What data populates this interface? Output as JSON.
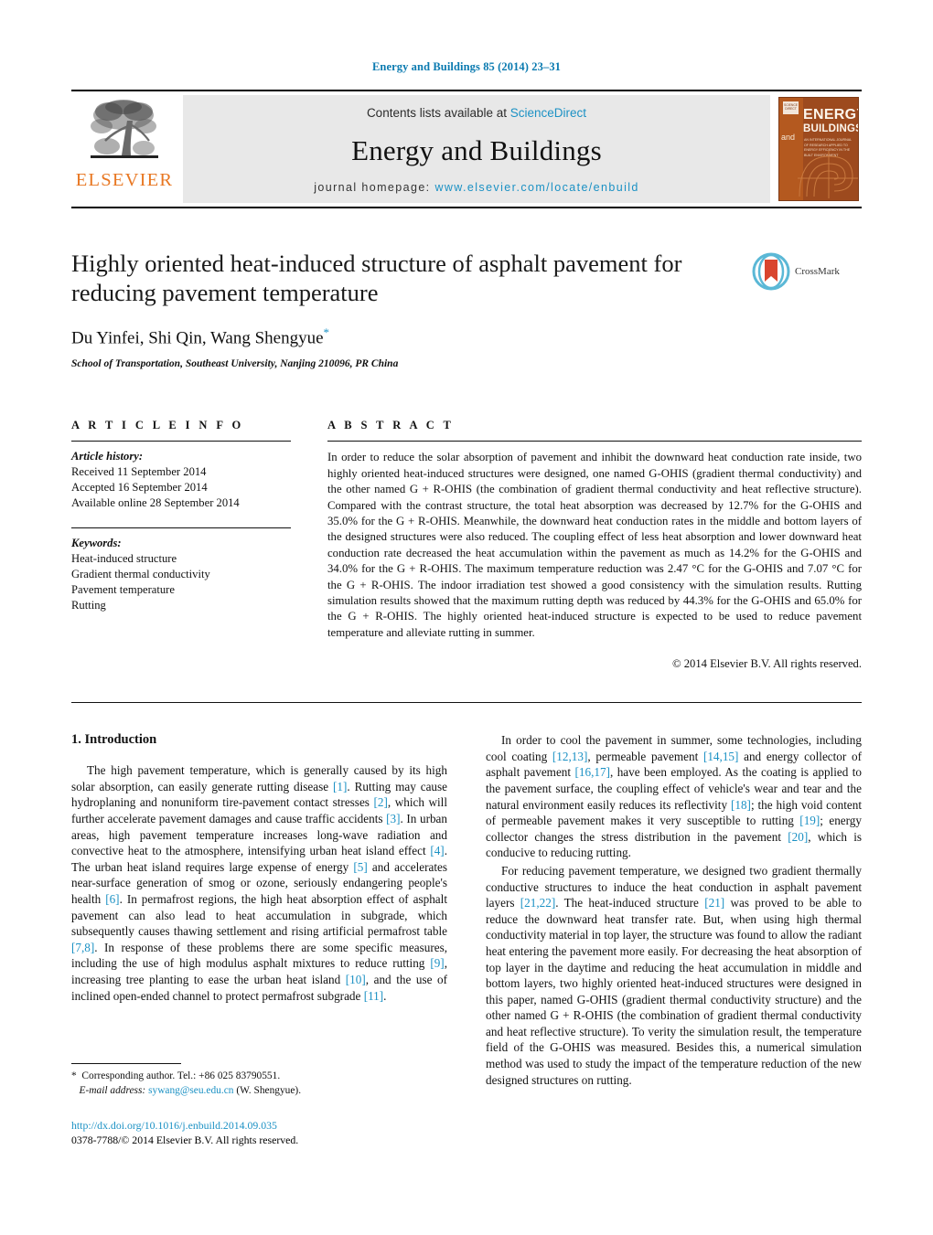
{
  "running_head": "Energy and Buildings 85 (2014) 23–31",
  "masthead": {
    "publisher_logo_text": "ELSEVIER",
    "contents_prefix": "Contents lists available at ",
    "contents_link": "ScienceDirect",
    "journal_name": "Energy and Buildings",
    "homepage_prefix": "journal homepage: ",
    "homepage_url": "www.elsevier.com/locate/enbuild",
    "cover": {
      "and_word": "and",
      "title_line1": "ENERGY",
      "title_line2": "BUILDINGS",
      "subtitle": "AN INTERNATIONAL JOURNAL OF RESEARCH APPLIED TO ENERGY EFFICIENCY IN THE BUILT ENVIRONMENT",
      "badge_text": "SCIENCE DIRECT"
    }
  },
  "article": {
    "title": "Highly oriented heat-induced structure of asphalt pavement for reducing pavement temperature",
    "authors": "Du Yinfei, Shi Qin, Wang Shengyue",
    "corresponding_marker": "*",
    "affiliation": "School of Transportation, Southeast University, Nanjing 210096, PR China",
    "crossmark_label": "CrossMark"
  },
  "article_info": {
    "heading": "A R T I C L E    I N F O",
    "history_label": "Article history:",
    "history": [
      "Received 11 September 2014",
      "Accepted 16 September 2014",
      "Available online 28 September 2014"
    ],
    "keywords_label": "Keywords:",
    "keywords": [
      "Heat-induced structure",
      "Gradient thermal conductivity",
      "Pavement temperature",
      "Rutting"
    ]
  },
  "abstract": {
    "heading": "A B S T R A C T",
    "text": "In order to reduce the solar absorption of pavement and inhibit the downward heat conduction rate inside, two highly oriented heat-induced structures were designed, one named G-OHIS (gradient thermal conductivity) and the other named G + R-OHIS (the combination of gradient thermal conductivity and heat reflective structure). Compared with the contrast structure, the total heat absorption was decreased by 12.7% for the G-OHIS and 35.0% for the G + R-OHIS. Meanwhile, the downward heat conduction rates in the middle and bottom layers of the designed structures were also reduced. The coupling effect of less heat absorption and lower downward heat conduction rate decreased the heat accumulation within the pavement as much as 14.2% for the G-OHIS and 34.0% for the G + R-OHIS. The maximum temperature reduction was 2.47 °C for the G-OHIS and 7.07 °C for the G + R-OHIS. The indoor irradiation test showed a good consistency with the simulation results. Rutting simulation results showed that the maximum rutting depth was reduced by 44.3% for the G-OHIS and 65.0% for the G + R-OHIS. The highly oriented heat-induced structure is expected to be used to reduce pavement temperature and alleviate rutting in summer.",
    "copyright": "© 2014 Elsevier B.V. All rights reserved."
  },
  "introduction": {
    "heading": "1.  Introduction",
    "left_paragraph_1_a": "The high pavement temperature, which is generally caused by its high solar absorption, can easily generate rutting disease ",
    "ref1": "[1]",
    "left_paragraph_1_b": ". Rutting may cause hydroplaning and nonuniform tire-pavement contact stresses ",
    "ref2": "[2]",
    "left_paragraph_1_c": ", which will further accelerate pavement damages and cause traffic accidents ",
    "ref3": "[3]",
    "left_paragraph_1_d": ". In urban areas, high pavement temperature increases long-wave radiation and convective heat to the atmosphere, intensifying urban heat island effect ",
    "ref4": "[4]",
    "left_paragraph_1_e": ". The urban heat island requires large expense of energy ",
    "ref5": "[5]",
    "left_paragraph_1_f": " and accelerates near-surface generation of smog or ozone, seriously endangering people's health ",
    "ref6": "[6]",
    "left_paragraph_1_g": ". In permafrost regions, the high heat absorption effect of asphalt pavement can also lead to heat accumulation in subgrade, which subsequently causes thawing settlement and rising artificial permafrost table ",
    "ref78": "[7,8]",
    "left_paragraph_1_h": ". In response of these problems there are some specific measures, including the use of high modulus asphalt mixtures to reduce rutting ",
    "ref9": "[9]",
    "left_paragraph_1_i": ", increasing tree planting to ease the urban heat island ",
    "ref10": "[10]",
    "left_paragraph_1_j": ", and the use of inclined open-ended channel to protect permafrost subgrade ",
    "ref11": "[11]",
    "left_paragraph_1_k": ".",
    "right_paragraph_1_a": "In order to cool the pavement in summer, some technologies, including cool coating ",
    "ref1213": "[12,13]",
    "right_paragraph_1_b": ", permeable pavement ",
    "ref1415": "[14,15]",
    "right_paragraph_1_c": " and energy collector of asphalt pavement ",
    "ref1617": "[16,17]",
    "right_paragraph_1_d": ", have been employed. As the coating is applied to the pavement surface, the coupling effect of vehicle's wear and tear and the natural environment easily reduces its reflectivity ",
    "ref18": "[18]",
    "right_paragraph_1_e": "; the high void content of permeable pavement makes it very susceptible to rutting ",
    "ref19": "[19]",
    "right_paragraph_1_f": "; energy collector changes the stress distribution in the pavement ",
    "ref20": "[20]",
    "right_paragraph_1_g": ", which is conducive to reducing rutting.",
    "right_paragraph_2_a": "For reducing pavement temperature, we designed two gradient thermally conductive structures to induce the heat conduction in asphalt pavement layers ",
    "ref2122": "[21,22]",
    "right_paragraph_2_b": ". The heat-induced structure ",
    "ref21": "[21]",
    "right_paragraph_2_c": " was proved to be able to reduce the downward heat transfer rate. But, when using high thermal conductivity material in top layer, the structure was found to allow the radiant heat entering the pavement more easily. For decreasing the heat absorption of top layer in the daytime and reducing the heat accumulation in middle and bottom layers, two highly oriented heat-induced structures were designed in this paper, named G-OHIS (gradient thermal conductivity structure) and the other named G + R-OHIS (the combination of gradient thermal conductivity and heat reflective structure). To verity the simulation result, the temperature field of the G-OHIS was measured. Besides this, a numerical simulation method was used to study the impact of the temperature reduction of the new designed structures on rutting."
  },
  "footnote": {
    "marker": "*",
    "corresponding": "Corresponding author. Tel.: +86 025 83790551.",
    "email_label": "E-mail address:",
    "email": "sywang@seu.edu.cn",
    "email_suffix": "(W. Shengyue).",
    "doi": "http://dx.doi.org/10.1016/j.enbuild.2014.09.035",
    "issn_line": "0378-7788/© 2014 Elsevier B.V. All rights reserved."
  },
  "colors": {
    "link": "#1b91c4",
    "elsevier_orange": "#E87722",
    "running_head": "#0a7ab0",
    "masthead_gray": "#e8e8e8"
  }
}
